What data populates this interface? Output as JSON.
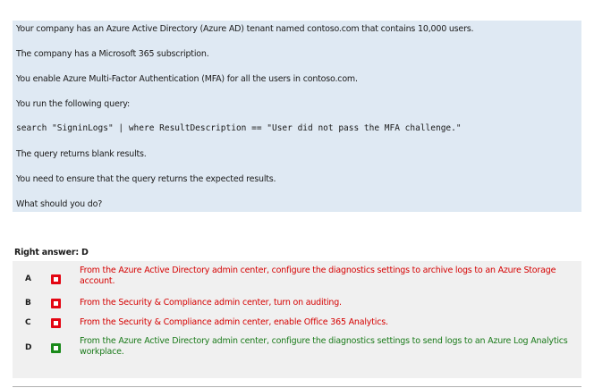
{
  "question": {
    "lines": [
      "Your company has an Azure Active Directory (Azure AD) tenant named contoso.com that contains 10,000 users.",
      "The company has a Microsoft 365 subscription.",
      "You enable Azure Multi-Factor Authentication (MFA) for all the users in contoso.com.",
      "You run the following query:",
      "search \"SigninLogs\" | where ResultDescription == \"User did not pass the MFA challenge.\"",
      "The query returns blank results.",
      "You need to ensure that the query returns the expected results.",
      "What should you do?"
    ]
  },
  "answer": {
    "label": "Right answer: D"
  },
  "options": [
    {
      "letter": "A",
      "status": "wrong",
      "text": "From the Azure Active Directory admin center, configure the diagnostics settings to archive logs to an Azure Storage account."
    },
    {
      "letter": "B",
      "status": "wrong",
      "text": "From the Security & Compliance admin center, turn on auditing."
    },
    {
      "letter": "C",
      "status": "wrong",
      "text": "From the Security & Compliance admin center, enable Office 365 Analytics."
    },
    {
      "letter": "D",
      "status": "right",
      "text": "From the Azure Active Directory admin center, configure the diagnostics settings to send logs to an Azure Log Analytics workplace."
    }
  ],
  "colors": {
    "question_bg": "#dfe9f3",
    "options_bg": "#f0f0f0",
    "wrong": "#e30613",
    "right": "#1a8a1a"
  }
}
